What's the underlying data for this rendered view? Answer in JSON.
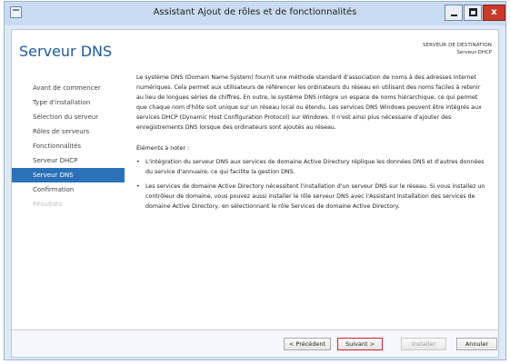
{
  "window": {
    "title": "Assistant Ajout de rôles et de fonctionnalités",
    "controls": {
      "minimize": "",
      "maximize": "",
      "close": "x"
    }
  },
  "header": {
    "page_title": "Serveur DNS",
    "destination_label": "SERVEUR DE DESTINATION",
    "destination_server": "Serveur-DHCP"
  },
  "nav": {
    "items": [
      {
        "label": "Avant de commencer",
        "state": "normal"
      },
      {
        "label": "Type d'installation",
        "state": "normal"
      },
      {
        "label": "Sélection du serveur",
        "state": "normal"
      },
      {
        "label": "Rôles de serveurs",
        "state": "normal"
      },
      {
        "label": "Fonctionnalités",
        "state": "normal"
      },
      {
        "label": "Serveur DHCP",
        "state": "normal"
      },
      {
        "label": "Serveur DNS",
        "state": "active"
      },
      {
        "label": "Confirmation",
        "state": "normal"
      },
      {
        "label": "Résultats",
        "state": "disabled"
      }
    ]
  },
  "content": {
    "intro": "Le système DNS (Domain Name System) fournit une méthode standard d'association de noms à des adresses Internet numériques. Cela permet aux utilisateurs de référencer les ordinateurs du réseau en utilisant des noms faciles à retenir au lieu de longues séries de chiffres. En outre, le système DNS intègre un espace de noms hiérarchique, ce qui permet que chaque nom d'hôte soit unique sur un réseau local ou étendu. Les services DNS Windows peuvent être intégrés aux services DHCP (Dynamic Host Configuration Protocol) sur Windows. Il n'est ainsi plus nécessaire d'ajouter des enregistrements DNS lorsque des ordinateurs sont ajoutés au réseau.",
    "notes_heading": "Éléments à noter :",
    "notes": [
      "L'intégration du serveur DNS aux services de domaine Active Directory réplique les données DNS et d'autres données du service d'annuaire, ce qui facilite la gestion DNS.",
      "Les services de domaine Active Directory nécessitent l'installation d'un serveur DNS sur le réseau. Si vous installez un contrôleur de domaine, vous pouvez aussi installer le rôle serveur DNS avec l'Assistant Installation des services de domaine Active Directory, en sélectionnant le rôle Services de domaine Active Directory."
    ],
    "bullet_glyph": "•"
  },
  "footer": {
    "previous": "< Précédent",
    "next": "Suivant >",
    "install": "Installer",
    "cancel": "Annuler"
  },
  "colors": {
    "title_blue": "#1c5a9c",
    "nav_active": "#2a71b8",
    "close_red": "#c83a2a",
    "highlight_red": "#d0202a"
  }
}
